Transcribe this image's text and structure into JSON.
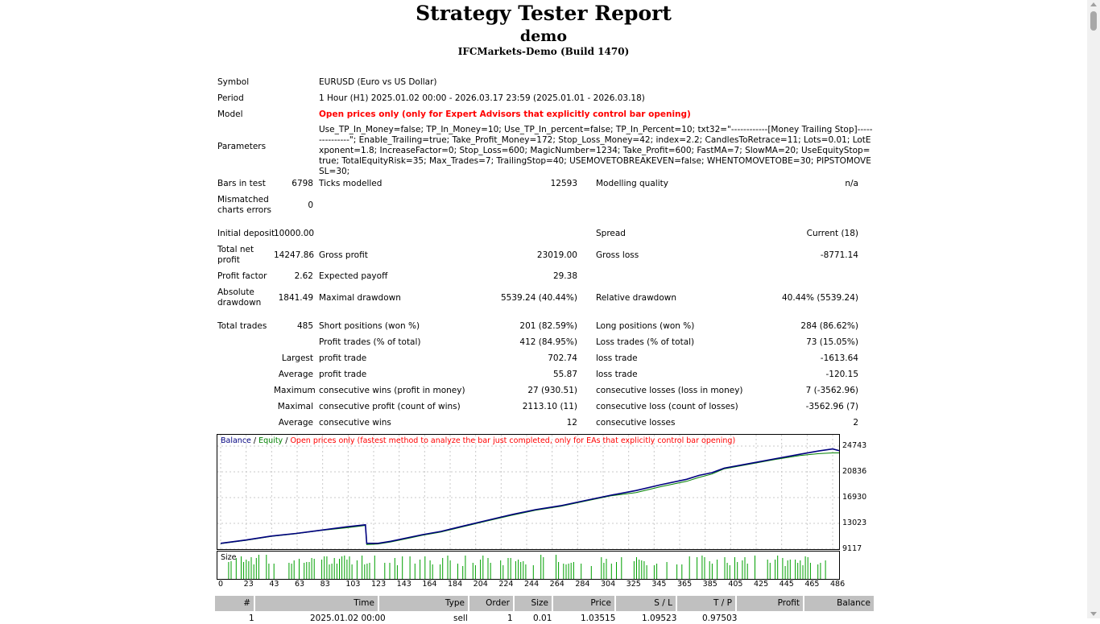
{
  "report": {
    "title": "Strategy Tester Report",
    "subtitle": "demo",
    "server": "IFCMarkets-Demo (Build 1470)"
  },
  "settings": {
    "symbol_label": "Symbol",
    "symbol_value": "EURUSD (Euro vs US Dollar)",
    "period_label": "Period",
    "period_value": "1 Hour (H1) 2025.01.02 00:00 - 2026.03.17 23:59 (2025.01.01 - 2026.03.18)",
    "model_label": "Model",
    "model_value": "Open prices only (only for Expert Advisors that explicitly control bar opening)",
    "parameters_label": "Parameters",
    "parameters_value": "Use_TP_In_Money=false; TP_In_Money=10; Use_TP_In_percent=false; TP_In_Percent=10; txt32=\"------------[Money Trailing Stop]---------------\"; Enable_Trailing=true; Take_Profit_Money=172; Stop_Loss_Money=42; index=2.2; CandlesToRetrace=11; Lots=0.01; LotExponent=1.8; IncreaseFactor=0; Stop_Loss=600; MagicNumber=1234; Take_Profit=600; FastMA=7; SlowMA=20; UseEquityStop=true; TotalEquityRisk=35; Max_Trades=7; TrailingStop=40; USEMOVETOBREAKEVEN=false; WHENTOMOVETOBE=30; PIPSTOMOVESL=30;"
  },
  "stats": {
    "bars_label": "Bars in test",
    "bars_value": "6798",
    "ticks_label": "Ticks modelled",
    "ticks_value": "12593",
    "quality_label": "Modelling quality",
    "quality_value": "n/a",
    "mismatch_label_1": "Mismatched",
    "mismatch_label_2": "charts errors",
    "mismatch_value": "0",
    "deposit_label": "Initial deposit",
    "deposit_value": "10000.00",
    "spread_label": "Spread",
    "spread_value": "Current (18)",
    "netprofit_label_1": "Total net",
    "netprofit_label_2": "profit",
    "netprofit_value": "14247.86",
    "grossprofit_label": "Gross profit",
    "grossprofit_value": "23019.00",
    "grossloss_label": "Gross loss",
    "grossloss_value": "-8771.14",
    "pf_label": "Profit factor",
    "pf_value": "2.62",
    "payoff_label": "Expected payoff",
    "payoff_value": "29.38",
    "absdd_label_1": "Absolute",
    "absdd_label_2": "drawdown",
    "absdd_value": "1841.49",
    "maxdd_label": "Maximal drawdown",
    "maxdd_value": "5539.24 (40.44%)",
    "reldd_label": "Relative drawdown",
    "reldd_value": "40.44% (5539.24)",
    "trades_label": "Total trades",
    "trades_value": "485",
    "short_label": "Short positions (won %)",
    "short_value": "201 (82.59%)",
    "long_label": "Long positions (won %)",
    "long_value": "284 (86.62%)",
    "profittrades_label": "Profit trades (% of total)",
    "profittrades_value": "412 (84.95%)",
    "losstrades_label": "Loss trades (% of total)",
    "losstrades_value": "73 (15.05%)",
    "largest_label": "Largest",
    "largest_pt_label": "profit trade",
    "largest_pt_value": "702.74",
    "largest_lt_label": "loss trade",
    "largest_lt_value": "-1613.64",
    "average_label": "Average",
    "average_pt_label": "profit trade",
    "average_pt_value": "55.87",
    "average_lt_label": "loss trade",
    "average_lt_value": "-120.15",
    "maximum_label": "Maximum",
    "max_cw_label": "consecutive wins (profit in money)",
    "max_cw_value": "27 (930.51)",
    "max_cl_label": "consecutive losses (loss in money)",
    "max_cl_value": "7 (-3562.96)",
    "maximal_label": "Maximal",
    "maximal_cp_label": "consecutive profit (count of wins)",
    "maximal_cp_value": "2113.10 (11)",
    "maximal_cl_label": "consecutive loss (count of losses)",
    "maximal_cl_value": "-3562.96 (7)",
    "average2_label": "Average",
    "avg_cw_label": "consecutive wins",
    "avg_cw_value": "12",
    "avg_cl_label": "consecutive losses",
    "avg_cl_value": "2"
  },
  "chart_legend": {
    "balance": "Balance",
    "sep1": " / ",
    "equity": "Equity",
    "sep2": " / ",
    "note": "Open prices only (fastest method to analyze the bar just completed, only for EAs that explicitly control bar opening)"
  },
  "size_label": "Size",
  "chart_data": {
    "type": "line",
    "yticks": [
      "24743",
      "20836",
      "16930",
      "13023",
      "9117"
    ],
    "ylim": [
      9117,
      24743
    ],
    "xticks": [
      "0",
      "23",
      "43",
      "63",
      "83",
      "103",
      "123",
      "143",
      "164",
      "184",
      "204",
      "224",
      "244",
      "264",
      "284",
      "304",
      "325",
      "345",
      "365",
      "385",
      "405",
      "425",
      "445",
      "465",
      "486"
    ],
    "xlim": [
      0,
      486
    ],
    "series": [
      {
        "name": "Balance",
        "color": "#000080",
        "points": [
          [
            0,
            10000
          ],
          [
            20,
            10500
          ],
          [
            40,
            11100
          ],
          [
            60,
            11500
          ],
          [
            80,
            12000
          ],
          [
            100,
            12500
          ],
          [
            115,
            12800
          ],
          [
            116,
            10000
          ],
          [
            125,
            10000
          ],
          [
            135,
            10300
          ],
          [
            150,
            10900
          ],
          [
            160,
            11300
          ],
          [
            175,
            11800
          ],
          [
            190,
            12500
          ],
          [
            210,
            13400
          ],
          [
            230,
            14300
          ],
          [
            250,
            15100
          ],
          [
            270,
            15700
          ],
          [
            290,
            16500
          ],
          [
            310,
            17300
          ],
          [
            330,
            18000
          ],
          [
            350,
            18900
          ],
          [
            370,
            19700
          ],
          [
            380,
            20300
          ],
          [
            390,
            20700
          ],
          [
            400,
            21400
          ],
          [
            420,
            22100
          ],
          [
            440,
            22800
          ],
          [
            460,
            23500
          ],
          [
            475,
            24000
          ],
          [
            486,
            24300
          ],
          [
            492,
            24000
          ]
        ]
      },
      {
        "name": "Equity",
        "color": "#008000",
        "points": [
          [
            0,
            9950
          ],
          [
            20,
            10450
          ],
          [
            40,
            11050
          ],
          [
            60,
            11450
          ],
          [
            80,
            11950
          ],
          [
            100,
            12350
          ],
          [
            115,
            12700
          ],
          [
            116,
            9800
          ],
          [
            125,
            9900
          ],
          [
            135,
            10200
          ],
          [
            150,
            10800
          ],
          [
            160,
            11200
          ],
          [
            175,
            11700
          ],
          [
            190,
            12400
          ],
          [
            210,
            13300
          ],
          [
            230,
            14200
          ],
          [
            250,
            15000
          ],
          [
            270,
            15600
          ],
          [
            290,
            16400
          ],
          [
            310,
            17200
          ],
          [
            330,
            17700
          ],
          [
            350,
            18600
          ],
          [
            370,
            19400
          ],
          [
            380,
            20000
          ],
          [
            390,
            20500
          ],
          [
            400,
            21300
          ],
          [
            420,
            22000
          ],
          [
            440,
            22700
          ],
          [
            460,
            23300
          ],
          [
            475,
            23600
          ],
          [
            486,
            23700
          ],
          [
            492,
            23700
          ]
        ]
      }
    ]
  },
  "table": {
    "headers": [
      "#",
      "Time",
      "Type",
      "Order",
      "Size",
      "Price",
      "S / L",
      "T / P",
      "Profit",
      "Balance"
    ],
    "first_row": [
      "1",
      "2025.01.02 00:00",
      "sell",
      "1",
      "0.01",
      "1.03515",
      "1.09523",
      "0.97503"
    ]
  }
}
